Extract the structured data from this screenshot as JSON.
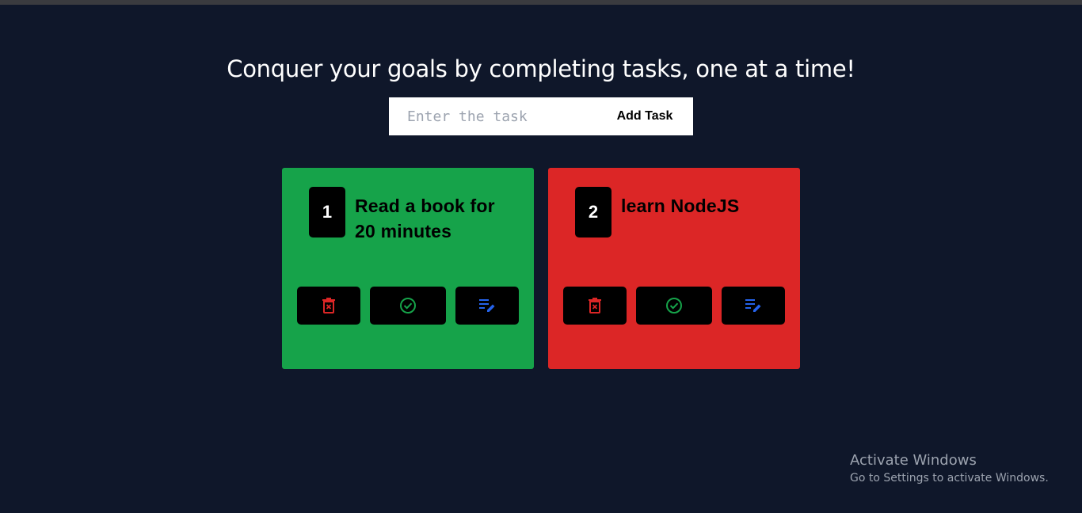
{
  "header": {
    "title": "Conquer your goals by completing tasks, one at a time!"
  },
  "form": {
    "input_placeholder": "Enter the task",
    "input_value": "",
    "add_label": "Add Task"
  },
  "tasks": [
    {
      "number": "1",
      "text": "Read a book for 20 minutes",
      "color": "#16a34a"
    },
    {
      "number": "2",
      "text": "learn NodeJS",
      "color": "#dc2626"
    }
  ],
  "actions": {
    "delete_icon": "trash-icon",
    "complete_icon": "check-circle-icon",
    "edit_icon": "edit-list-icon",
    "delete_color": "#dc2626",
    "complete_color": "#16a34a",
    "edit_color": "#2563eb"
  },
  "watermark": {
    "title": "Activate Windows",
    "subtitle": "Go to Settings to activate Windows."
  }
}
